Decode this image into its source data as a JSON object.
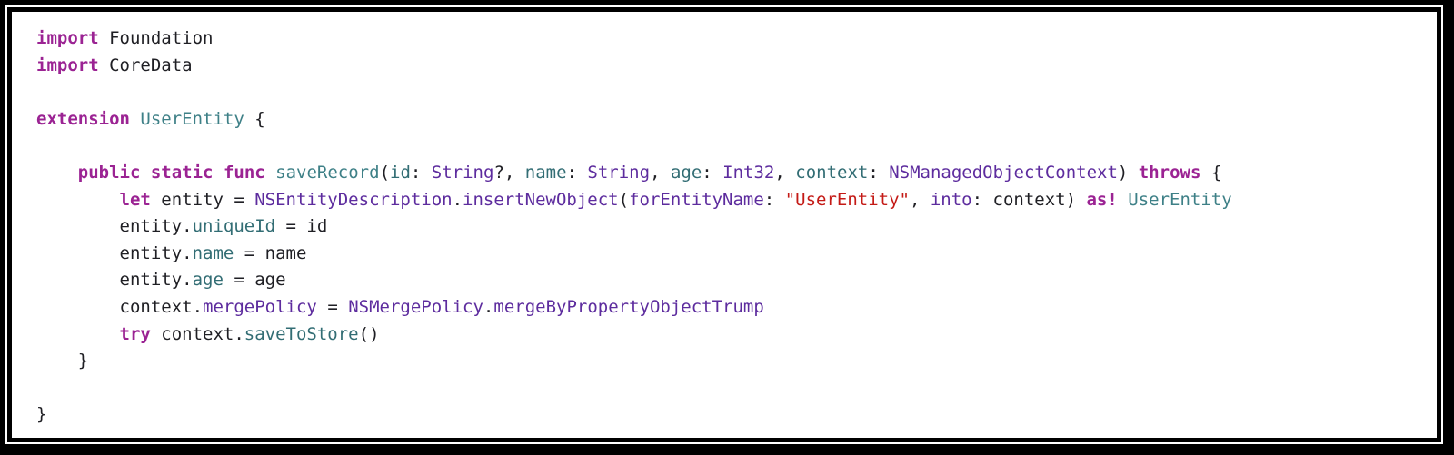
{
  "colors": {
    "keyword": "#9b2393",
    "type": "#3e8087",
    "external": "#5d2c9e",
    "property": "#326d74",
    "string": "#c41a16",
    "plain": "#1f1f24",
    "background": "#ffffff",
    "frame": "#000000"
  },
  "code": {
    "lines": [
      [
        {
          "t": "import",
          "c": "kw"
        },
        {
          "t": " Foundation",
          "c": "plain"
        }
      ],
      [
        {
          "t": "import",
          "c": "kw"
        },
        {
          "t": " CoreData",
          "c": "plain"
        }
      ],
      [],
      [
        {
          "t": "extension",
          "c": "kw"
        },
        {
          "t": " ",
          "c": "plain"
        },
        {
          "t": "UserEntity",
          "c": "type"
        },
        {
          "t": " {",
          "c": "plain"
        }
      ],
      [],
      [
        {
          "t": "    ",
          "c": "plain"
        },
        {
          "t": "public",
          "c": "kw"
        },
        {
          "t": " ",
          "c": "plain"
        },
        {
          "t": "static",
          "c": "kw"
        },
        {
          "t": " ",
          "c": "plain"
        },
        {
          "t": "func",
          "c": "kw"
        },
        {
          "t": " ",
          "c": "plain"
        },
        {
          "t": "saveRecord",
          "c": "type"
        },
        {
          "t": "(",
          "c": "plain"
        },
        {
          "t": "id",
          "c": "prop"
        },
        {
          "t": ": ",
          "c": "plain"
        },
        {
          "t": "String",
          "c": "ext"
        },
        {
          "t": "?, ",
          "c": "plain"
        },
        {
          "t": "name",
          "c": "prop"
        },
        {
          "t": ": ",
          "c": "plain"
        },
        {
          "t": "String",
          "c": "ext"
        },
        {
          "t": ", ",
          "c": "plain"
        },
        {
          "t": "age",
          "c": "prop"
        },
        {
          "t": ": ",
          "c": "plain"
        },
        {
          "t": "Int32",
          "c": "ext"
        },
        {
          "t": ", ",
          "c": "plain"
        },
        {
          "t": "context",
          "c": "prop"
        },
        {
          "t": ": ",
          "c": "plain"
        },
        {
          "t": "NSManagedObjectContext",
          "c": "ext"
        },
        {
          "t": ") ",
          "c": "plain"
        },
        {
          "t": "throws",
          "c": "kw"
        },
        {
          "t": " {",
          "c": "plain"
        }
      ],
      [
        {
          "t": "        ",
          "c": "plain"
        },
        {
          "t": "let",
          "c": "kw"
        },
        {
          "t": " entity = ",
          "c": "plain"
        },
        {
          "t": "NSEntityDescription",
          "c": "ext"
        },
        {
          "t": ".",
          "c": "plain"
        },
        {
          "t": "insertNewObject",
          "c": "ext"
        },
        {
          "t": "(",
          "c": "plain"
        },
        {
          "t": "forEntityName",
          "c": "ext"
        },
        {
          "t": ": ",
          "c": "plain"
        },
        {
          "t": "\"UserEntity\"",
          "c": "str"
        },
        {
          "t": ", ",
          "c": "plain"
        },
        {
          "t": "into",
          "c": "ext"
        },
        {
          "t": ": context) ",
          "c": "plain"
        },
        {
          "t": "as!",
          "c": "kw"
        },
        {
          "t": " ",
          "c": "plain"
        },
        {
          "t": "UserEntity",
          "c": "type"
        }
      ],
      [
        {
          "t": "        entity.",
          "c": "plain"
        },
        {
          "t": "uniqueId",
          "c": "prop"
        },
        {
          "t": " = id",
          "c": "plain"
        }
      ],
      [
        {
          "t": "        entity.",
          "c": "plain"
        },
        {
          "t": "name",
          "c": "prop"
        },
        {
          "t": " = name",
          "c": "plain"
        }
      ],
      [
        {
          "t": "        entity.",
          "c": "plain"
        },
        {
          "t": "age",
          "c": "prop"
        },
        {
          "t": " = age",
          "c": "plain"
        }
      ],
      [
        {
          "t": "        context.",
          "c": "plain"
        },
        {
          "t": "mergePolicy",
          "c": "ext"
        },
        {
          "t": " = ",
          "c": "plain"
        },
        {
          "t": "NSMergePolicy",
          "c": "ext"
        },
        {
          "t": ".",
          "c": "plain"
        },
        {
          "t": "mergeByPropertyObjectTrump",
          "c": "ext"
        }
      ],
      [
        {
          "t": "        ",
          "c": "plain"
        },
        {
          "t": "try",
          "c": "kw"
        },
        {
          "t": " context.",
          "c": "plain"
        },
        {
          "t": "saveToStore",
          "c": "prop"
        },
        {
          "t": "()",
          "c": "plain"
        }
      ],
      [
        {
          "t": "    }",
          "c": "plain"
        }
      ],
      [],
      [
        {
          "t": "}",
          "c": "plain"
        }
      ]
    ]
  }
}
